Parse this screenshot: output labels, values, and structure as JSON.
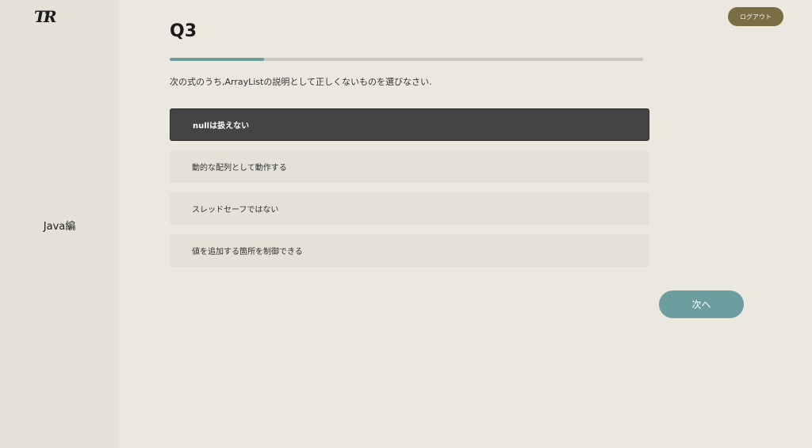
{
  "logo": "TR",
  "sidebar": {
    "section_label": "Java編"
  },
  "header": {
    "logout_label": "ログアウト"
  },
  "quiz": {
    "title": "Q3",
    "progress": 0.2,
    "question": "次の式のうち,ArrayListの説明として正しくないものを選びなさい.",
    "options": [
      {
        "label": "nullは扱えない",
        "selected": true
      },
      {
        "label": "動的な配列として動作する",
        "selected": false
      },
      {
        "label": "スレッドセーフではない",
        "selected": false
      },
      {
        "label": "値を追加する箇所を制御できる",
        "selected": false
      }
    ],
    "next_label": "次へ"
  },
  "colors": {
    "background": "#ebe8df",
    "sidebar": "#e4e1d6",
    "accent": "#6c9ea0",
    "logout": "#7a6d44",
    "selected_option": "#444444"
  }
}
